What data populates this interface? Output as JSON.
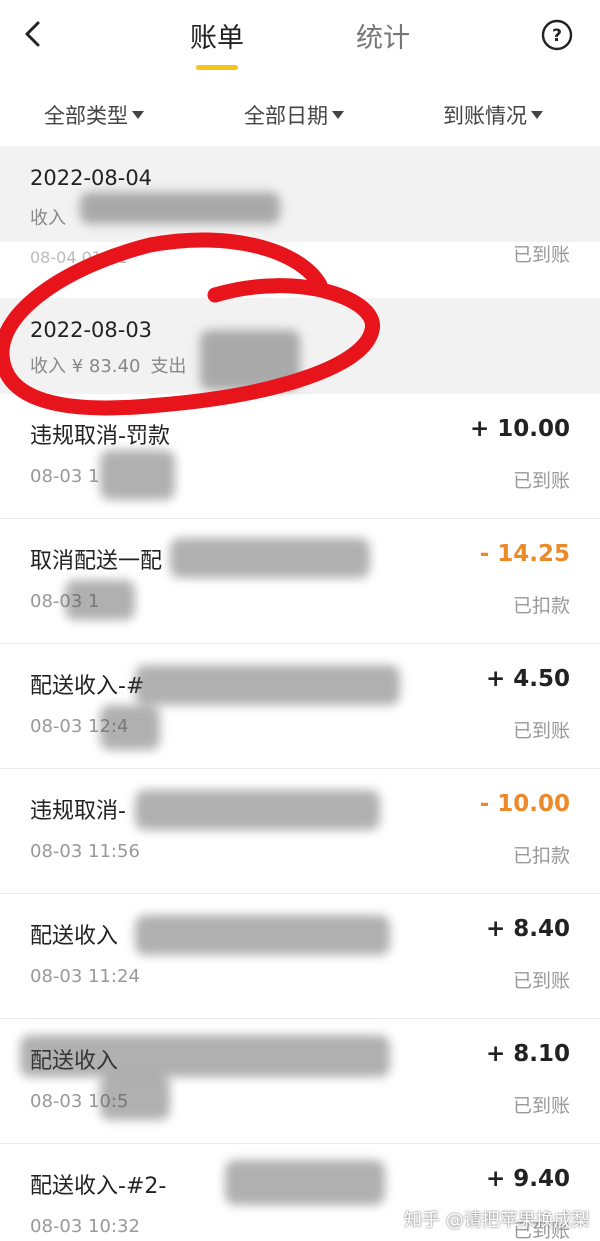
{
  "header": {
    "tabs": [
      {
        "label": "账单",
        "active": true
      },
      {
        "label": "统计",
        "active": false
      }
    ],
    "accent": "#f5c51a"
  },
  "filters": [
    {
      "label": "全部类型"
    },
    {
      "label": "全部日期"
    },
    {
      "label": "到账情况"
    }
  ],
  "groups": [
    {
      "date": "2022-08-04",
      "summary": "收入",
      "partial_row": {
        "time": "08-04 01:11",
        "status": "已到账"
      }
    },
    {
      "date": "2022-08-03",
      "summary_income": "收入 ¥ 83.40",
      "summary_expense": "支出"
    }
  ],
  "rows": [
    {
      "title": "违规取消-罚款",
      "time": "08-03 1",
      "amount": "+ 10.00",
      "status": "已到账",
      "negative": false
    },
    {
      "title": "取消配送一配",
      "time": "08-03 1",
      "amount": "- 14.25",
      "status": "已扣款",
      "negative": true
    },
    {
      "title": "配送收入-#",
      "time": "08-03 12:4",
      "amount": "+ 4.50",
      "status": "已到账",
      "negative": false
    },
    {
      "title": "违规取消-",
      "time": "08-03 11:56",
      "amount": "- 10.00",
      "status": "已扣款",
      "negative": true
    },
    {
      "title": "配送收入",
      "time": "08-03 11:24",
      "amount": "+ 8.40",
      "status": "已到账",
      "negative": false
    },
    {
      "title": "配送收入",
      "time": "08-03 10:5",
      "amount": "+ 8.10",
      "status": "已到账",
      "negative": false
    },
    {
      "title": "配送收入-#2-",
      "time": "08-03 10:32",
      "amount": "+ 9.40",
      "status": "已到账",
      "negative": false
    }
  ],
  "watermark": "知乎 @请把苹果换成梨",
  "colors": {
    "negative_amount": "#ec8a2a",
    "annotation_loop": "#e8141b"
  }
}
